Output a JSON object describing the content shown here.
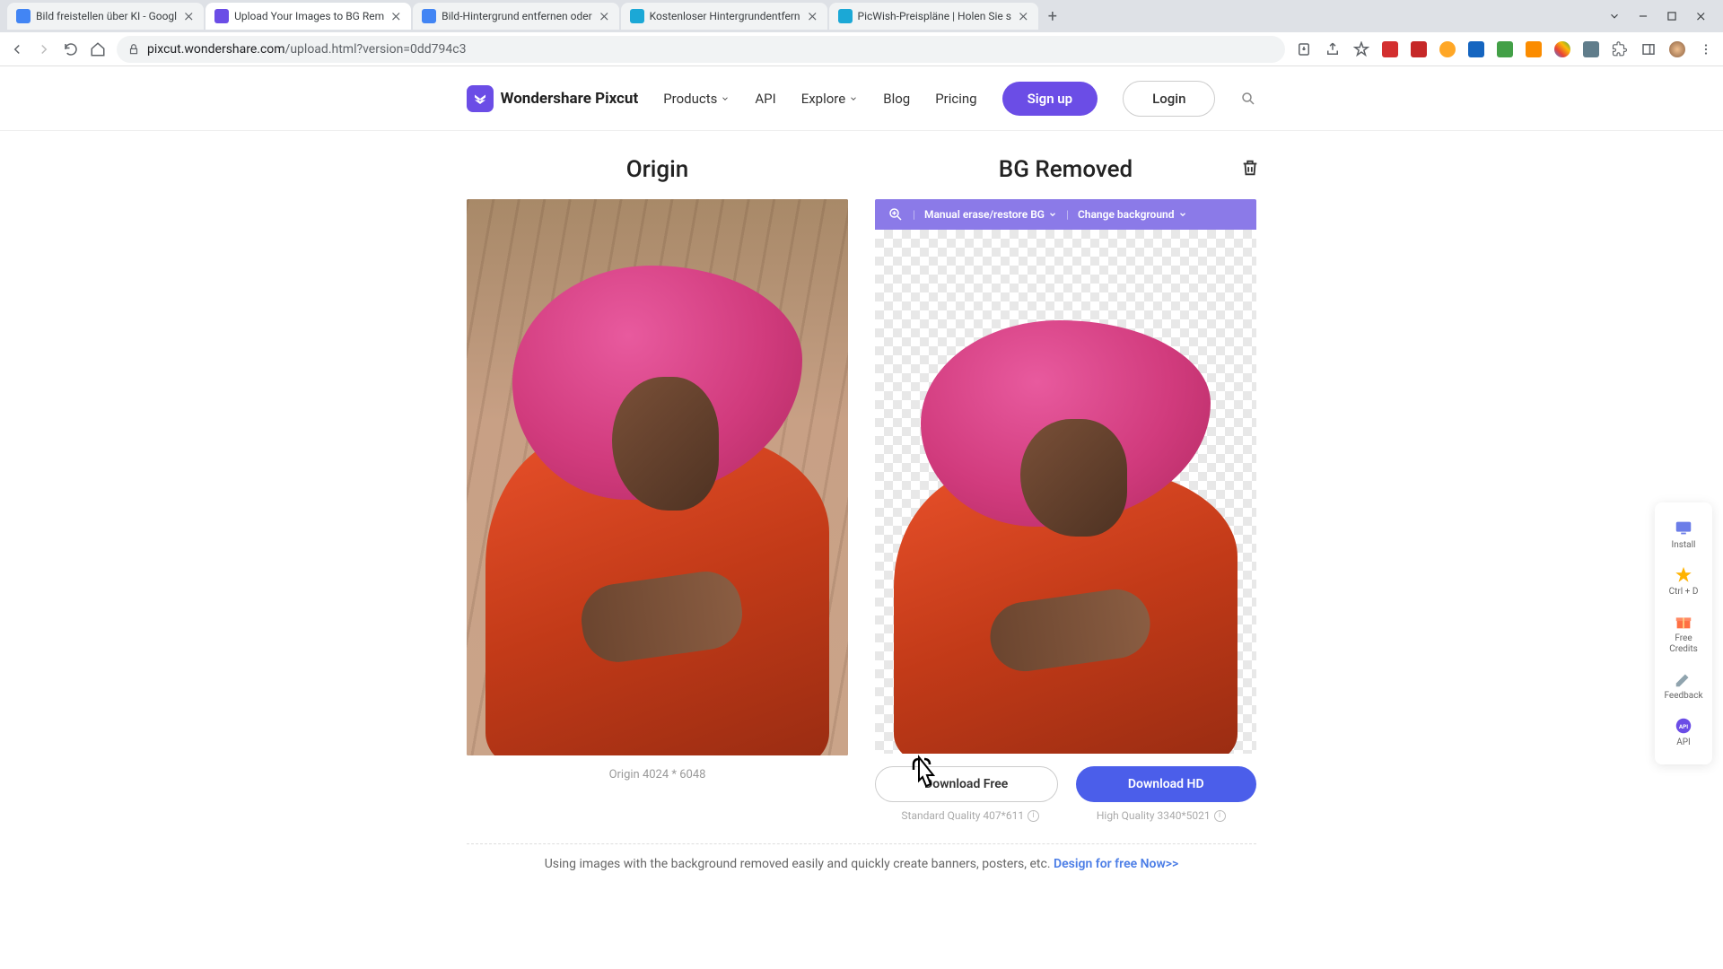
{
  "browser": {
    "tabs": [
      {
        "title": "Bild freistellen über KI - Googl",
        "favicon": "#4285f4"
      },
      {
        "title": "Upload Your Images to BG Rem",
        "favicon": "#6b4de6",
        "active": true
      },
      {
        "title": "Bild-Hintergrund entfernen oder",
        "favicon": "#4285f4"
      },
      {
        "title": "Kostenloser Hintergrundentfern",
        "favicon": "#1ba8d6"
      },
      {
        "title": "PicWish-Preispläne | Holen Sie s",
        "favicon": "#1ba8d6"
      }
    ],
    "url_domain": "pixcut.wondershare.com",
    "url_path": "/upload.html?version=0dd794c3"
  },
  "header": {
    "logo": "Wondershare Pixcut",
    "nav": {
      "products": "Products",
      "api": "API",
      "explore": "Explore",
      "blog": "Blog",
      "pricing": "Pricing"
    },
    "signup": "Sign up",
    "login": "Login"
  },
  "panels": {
    "origin_title": "Origin",
    "removed_title": "BG Removed",
    "origin_caption": "Origin 4024 * 6048",
    "toolbar": {
      "erase": "Manual erase/restore BG",
      "change": "Change background"
    }
  },
  "download": {
    "free": "Download Free",
    "hd": "Download HD",
    "free_cap": "Standard Quality 407*611",
    "hd_cap": "High Quality 3340*5021"
  },
  "footer": {
    "text": "Using images with the background removed easily and quickly create banners, posters, etc. ",
    "link": "Design for free Now>>"
  },
  "floatbar": {
    "install": "Install",
    "shortcut": "Ctrl + D",
    "credits1": "Free",
    "credits2": "Credits",
    "feedback": "Feedback",
    "api": "API"
  }
}
